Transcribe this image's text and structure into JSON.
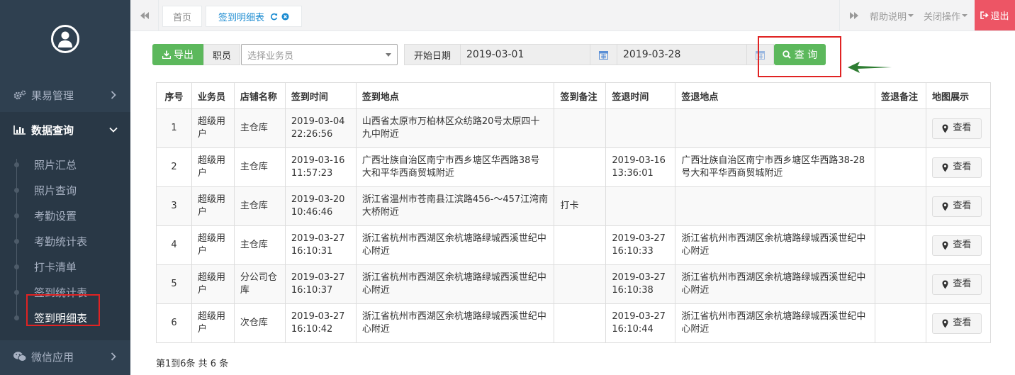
{
  "sidebar": {
    "menus": [
      {
        "label": "果易管理"
      },
      {
        "label": "数据查询"
      }
    ],
    "submenu": [
      "照片汇总",
      "照片查询",
      "考勤设置",
      "考勤统计表",
      "打卡清单",
      "签到统计表",
      "签到明细表"
    ],
    "bottom_menu": {
      "label": "微信应用"
    }
  },
  "topbar": {
    "tabs": [
      "首页",
      "签到明细表"
    ],
    "help": "帮助说明",
    "close_ops": "关闭操作",
    "logout": "退出"
  },
  "toolbar": {
    "export_label": "导出",
    "employee_label": "职员",
    "employee_placeholder": "选择业务员",
    "start_date_label": "开始日期",
    "start_date": "2019-03-01",
    "end_date": "2019-03-28",
    "query_label": "查 询"
  },
  "table": {
    "headers": [
      "序号",
      "业务员",
      "店铺名称",
      "签到时间",
      "签到地点",
      "签到备注",
      "签退时间",
      "签退地点",
      "签退备注",
      "地图展示"
    ],
    "view_label": "查看",
    "rows": [
      {
        "no": "1",
        "staff": "超级用户",
        "store": "主仓库",
        "checkin_time": "2019-03-04 22:26:56",
        "checkin_place": "山西省太原市万柏林区众纺路20号太原四十九中附近",
        "checkin_note": "",
        "checkout_time": "",
        "checkout_place": "",
        "checkout_note": ""
      },
      {
        "no": "2",
        "staff": "超级用户",
        "store": "主仓库",
        "checkin_time": "2019-03-16 11:57:23",
        "checkin_place": "广西壮族自治区南宁市西乡塘区华西路38号大和平华西商贸城附近",
        "checkin_note": "",
        "checkout_time": "2019-03-16 13:36:01",
        "checkout_place": "广西壮族自治区南宁市西乡塘区华西路38-28号大和平华西商贸城附近",
        "checkout_note": ""
      },
      {
        "no": "3",
        "staff": "超级用户",
        "store": "主仓库",
        "checkin_time": "2019-03-20 10:46:46",
        "checkin_place": "浙江省温州市苍南县江滨路456-～457江湾南大桥附近",
        "checkin_note": "打卡",
        "checkout_time": "",
        "checkout_place": "",
        "checkout_note": ""
      },
      {
        "no": "4",
        "staff": "超级用户",
        "store": "主仓库",
        "checkin_time": "2019-03-27 16:10:31",
        "checkin_place": "浙江省杭州市西湖区余杭塘路绿城西溪世纪中心附近",
        "checkin_note": "",
        "checkout_time": "2019-03-27 16:10:33",
        "checkout_place": "浙江省杭州市西湖区余杭塘路绿城西溪世纪中心附近",
        "checkout_note": ""
      },
      {
        "no": "5",
        "staff": "超级用户",
        "store": "分公司仓库",
        "checkin_time": "2019-03-27 16:10:37",
        "checkin_place": "浙江省杭州市西湖区余杭塘路绿城西溪世纪中心附近",
        "checkin_note": "",
        "checkout_time": "2019-03-27 16:10:38",
        "checkout_place": "浙江省杭州市西湖区余杭塘路绿城西溪世纪中心附近",
        "checkout_note": ""
      },
      {
        "no": "6",
        "staff": "超级用户",
        "store": "次仓库",
        "checkin_time": "2019-03-27 16:10:42",
        "checkin_place": "浙江省杭州市西湖区余杭塘路绿城西溪世纪中心附近",
        "checkin_note": "",
        "checkout_time": "2019-03-27 16:10:44",
        "checkout_place": "浙江省杭州市西湖区余杭塘路绿城西溪世纪中心附近",
        "checkout_note": ""
      }
    ]
  },
  "pagination": {
    "summary": "第1到6条 共 6 条"
  },
  "colors": {
    "sidebar": "#2f4050",
    "green": "#5cb85c",
    "logout": "#ed5565",
    "highlight": "#e02323",
    "arrow": "#2e7d32"
  }
}
